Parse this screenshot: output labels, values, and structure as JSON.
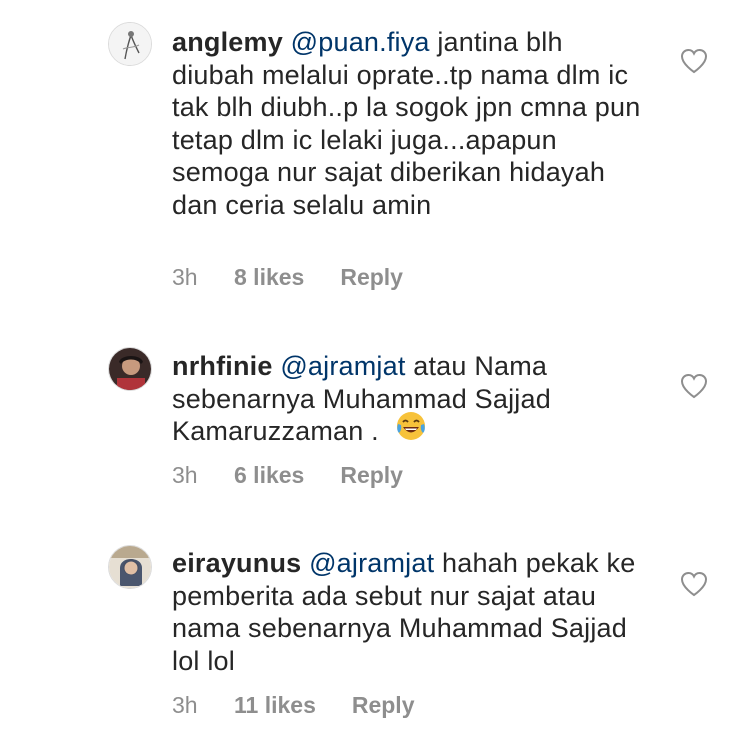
{
  "comments": [
    {
      "username": "anglemy",
      "mention": "@puan.fiya",
      "text": "jantina blh diubah melalui oprate..tp nama dlm ic tak blh diubh..p la sogok jpn cmna pun tetap dlm ic lelaki juga...apapun semoga nur sajat diberikan hidayah dan ceria selalu amin",
      "time": "3h",
      "likes": "8 likes",
      "reply": "Reply",
      "avatar_icon": "avatar-icon",
      "like_icon": "heart-outline-icon"
    },
    {
      "username": "nrhfinie",
      "mention": "@ajramjat",
      "text": "atau Nama sebenarnya Muhammad Sajjad Kamaruzzaman .",
      "emoji": "face-with-tears-of-joy",
      "time": "3h",
      "likes": "6 likes",
      "reply": "Reply",
      "avatar_icon": "avatar-icon",
      "like_icon": "heart-outline-icon"
    },
    {
      "username": "eirayunus",
      "mention": "@ajramjat",
      "text": "hahah pekak ke pemberita ada  sebut nur sajat atau nama sebenarnya Muhammad Sajjad lol lol",
      "time": "3h",
      "likes": "11 likes",
      "reply": "Reply",
      "avatar_icon": "avatar-icon",
      "like_icon": "heart-outline-icon"
    }
  ],
  "colors": {
    "text": "#262626",
    "mention": "#003569",
    "meta": "#8e8e8e",
    "heart_stroke": "#8e8e8e"
  }
}
